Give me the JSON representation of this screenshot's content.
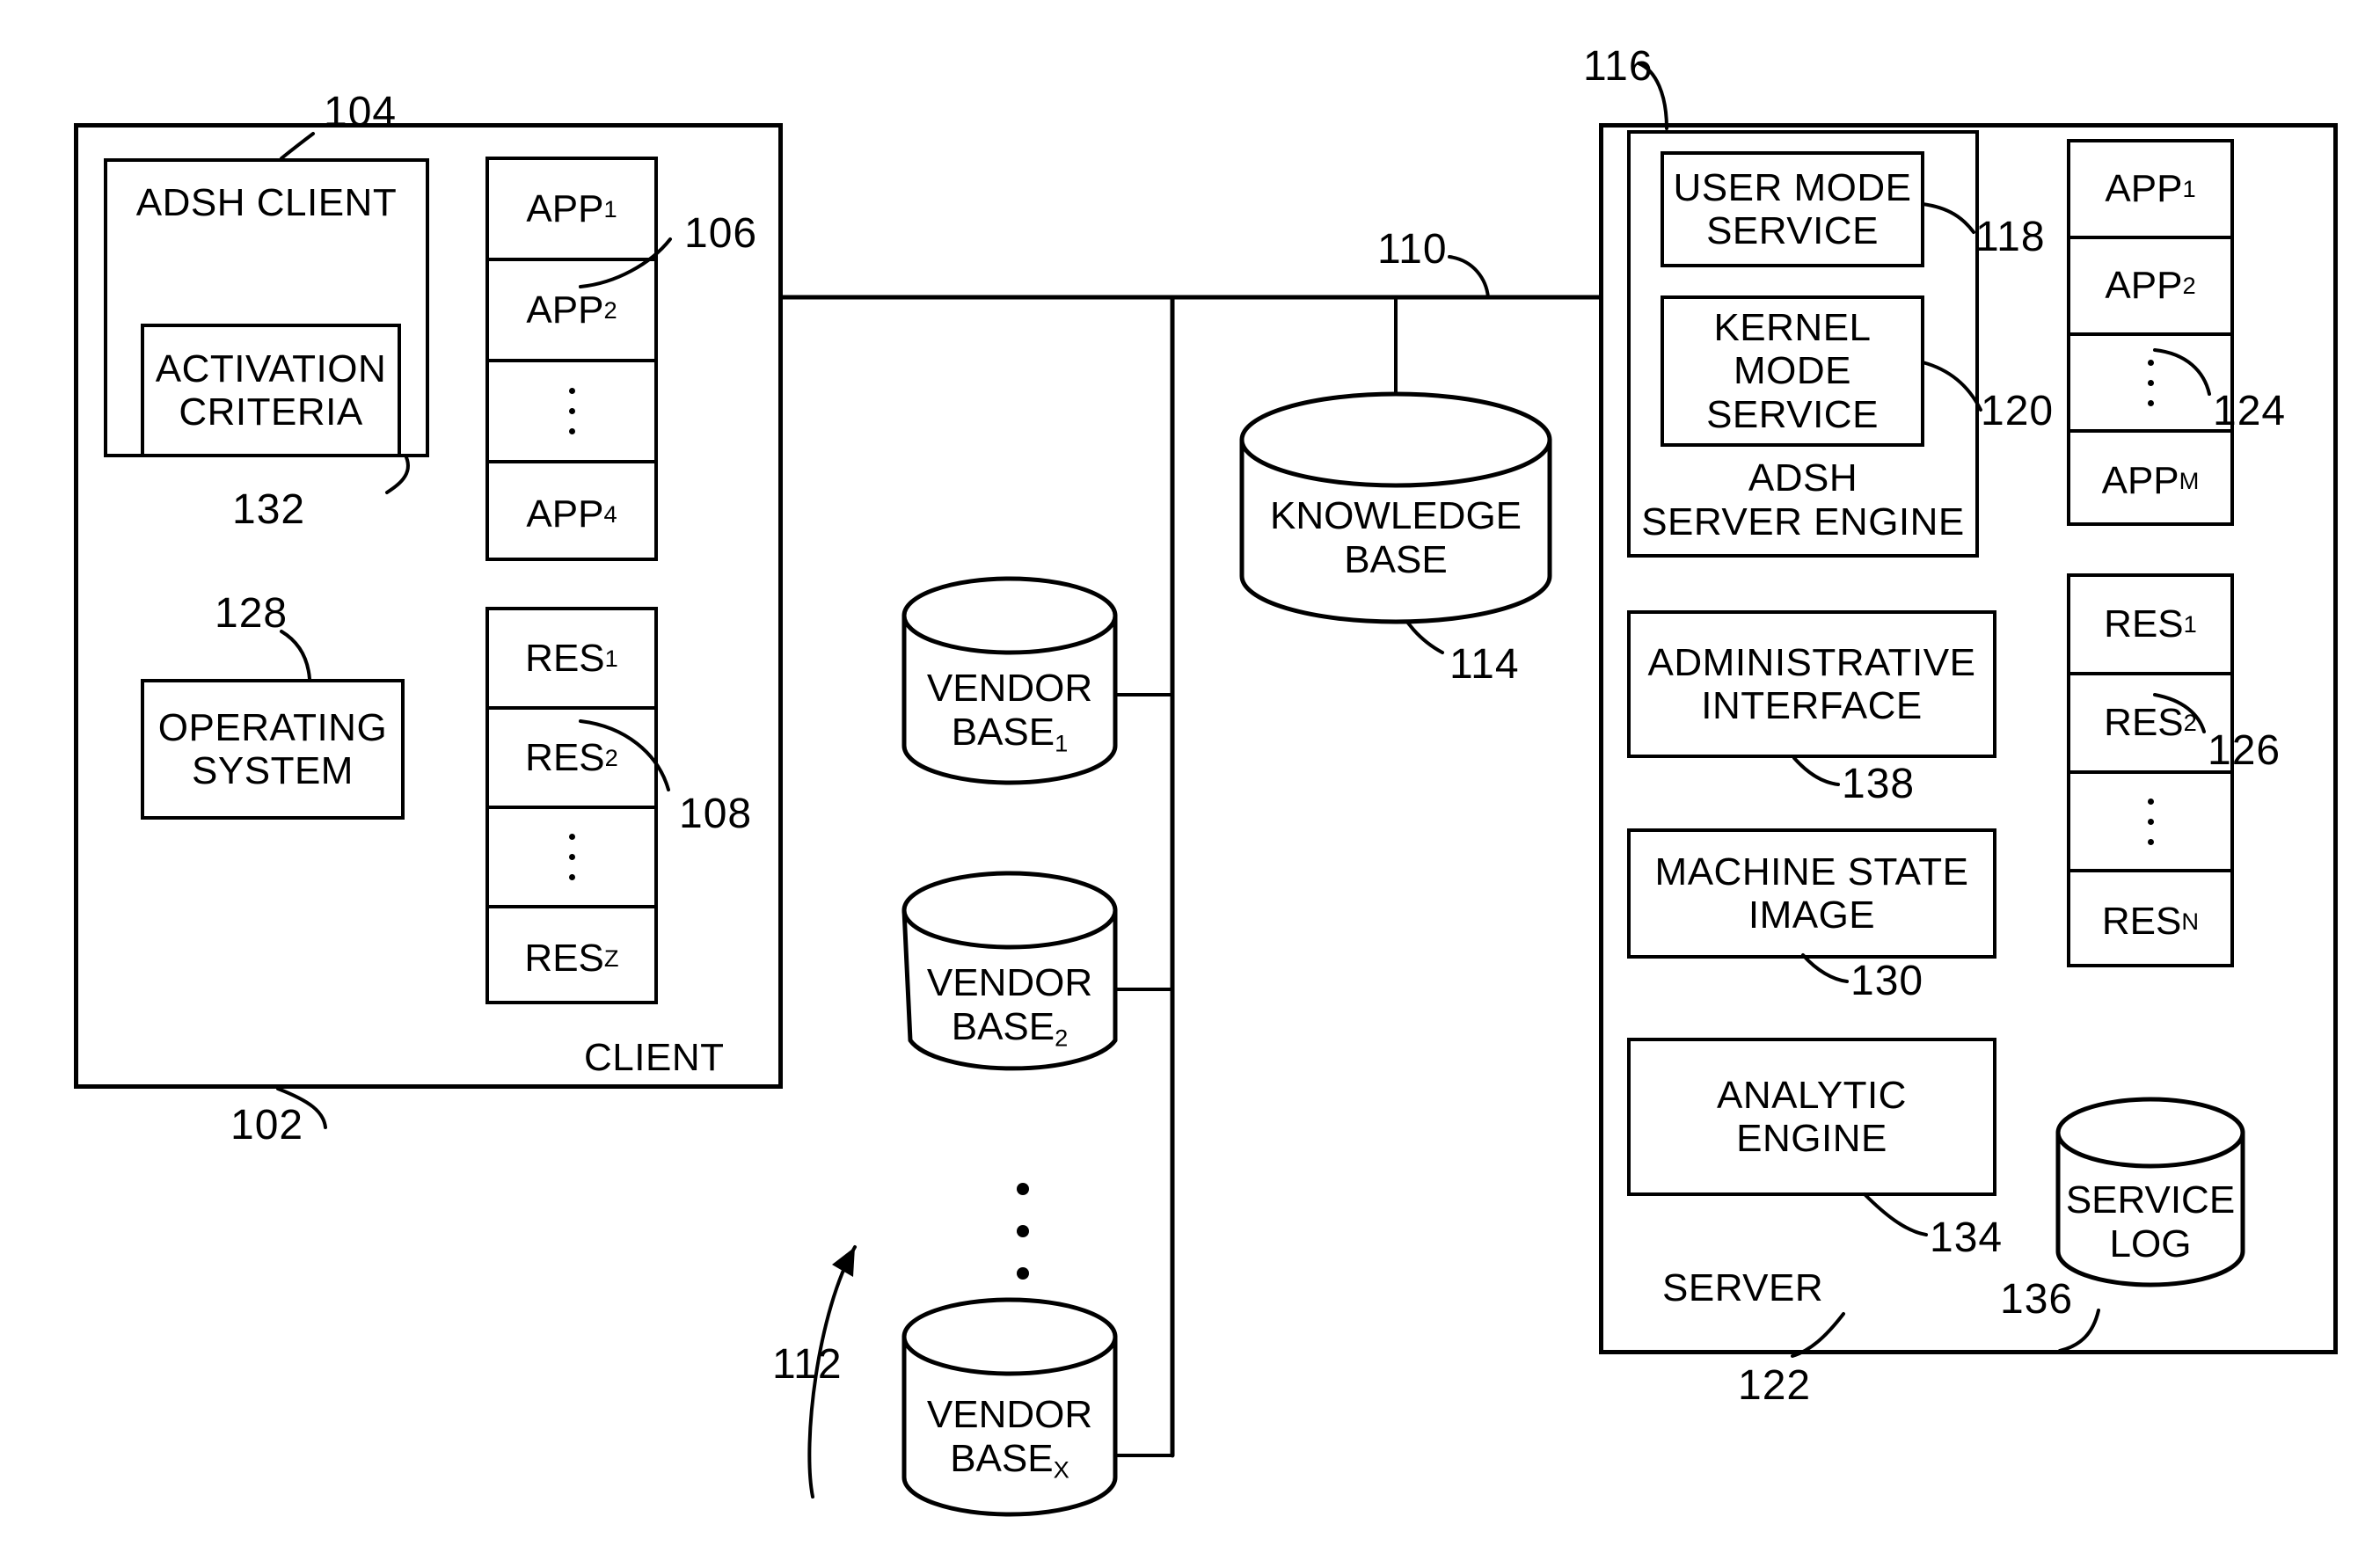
{
  "figure": {
    "title": "ADSH client-server system block diagram",
    "line_color": "#000000",
    "background": "#ffffff"
  },
  "client": {
    "container_label": "CLIENT",
    "container_ref": "102",
    "adsh_client": {
      "label": "ADSH CLIENT",
      "ref": "104",
      "activation_criteria": {
        "label_line1": "ACTIVATION",
        "label_line2": "CRITERIA",
        "ref": "132"
      }
    },
    "operating_system": {
      "label_line1": "OPERATING",
      "label_line2": "SYSTEM",
      "ref": "128"
    },
    "app_stack": {
      "ref": "106",
      "items": [
        "APP1",
        "APP2",
        "dots",
        "APP4"
      ],
      "labels": [
        {
          "base": "APP",
          "sub": "1"
        },
        {
          "base": "APP",
          "sub": "2"
        },
        {
          "base": "",
          "sub": ""
        },
        {
          "base": "APP",
          "sub": "4"
        }
      ]
    },
    "res_stack": {
      "ref": "108",
      "labels": [
        {
          "base": "RES",
          "sub": "1"
        },
        {
          "base": "RES",
          "sub": "2"
        },
        {
          "base": "",
          "sub": ""
        },
        {
          "base": "RES",
          "sub": "Z"
        }
      ]
    }
  },
  "network": {
    "ref": "110"
  },
  "knowledge_base": {
    "label_line1": "KNOWLEDGE",
    "label_line2": "BASE",
    "ref": "114"
  },
  "vendor_bases": {
    "ref": "112",
    "items": [
      {
        "line1": "VENDOR",
        "base": "BASE",
        "sub": "1"
      },
      {
        "line1": "VENDOR",
        "base": "BASE",
        "sub": "2"
      },
      {
        "line1": "VENDOR",
        "base": "BASE",
        "sub": "X"
      }
    ]
  },
  "server": {
    "container_label": "SERVER",
    "container_ref": "122",
    "adsh_server_engine": {
      "label_line1": "ADSH",
      "label_line2": "SERVER ENGINE",
      "ref": "116",
      "user_mode_service": {
        "label_line1": "USER MODE",
        "label_line2": "SERVICE",
        "ref": "118"
      },
      "kernel_mode_service": {
        "label_line1": "KERNEL",
        "label_line2": "MODE",
        "label_line3": "SERVICE",
        "ref": "120"
      }
    },
    "administrative_interface": {
      "label_line1": "ADMINISTRATIVE",
      "label_line2": "INTERFACE",
      "ref": "138"
    },
    "machine_state_image": {
      "label_line1": "MACHINE STATE",
      "label_line2": "IMAGE",
      "ref": "130"
    },
    "analytic_engine": {
      "label": "ANALYTIC ENGINE",
      "ref": "134"
    },
    "service_log": {
      "label_line1": "SERVICE",
      "label_line2": "LOG",
      "ref": "136"
    },
    "app_stack": {
      "ref": "124",
      "labels": [
        {
          "base": "APP",
          "sub": "1"
        },
        {
          "base": "APP",
          "sub": "2"
        },
        {
          "base": "",
          "sub": ""
        },
        {
          "base": "APP",
          "sub": "M"
        }
      ]
    },
    "res_stack": {
      "ref": "126",
      "labels": [
        {
          "base": "RES",
          "sub": "1"
        },
        {
          "base": "RES",
          "sub": "2"
        },
        {
          "base": "",
          "sub": ""
        },
        {
          "base": "RES",
          "sub": "N"
        }
      ]
    }
  }
}
